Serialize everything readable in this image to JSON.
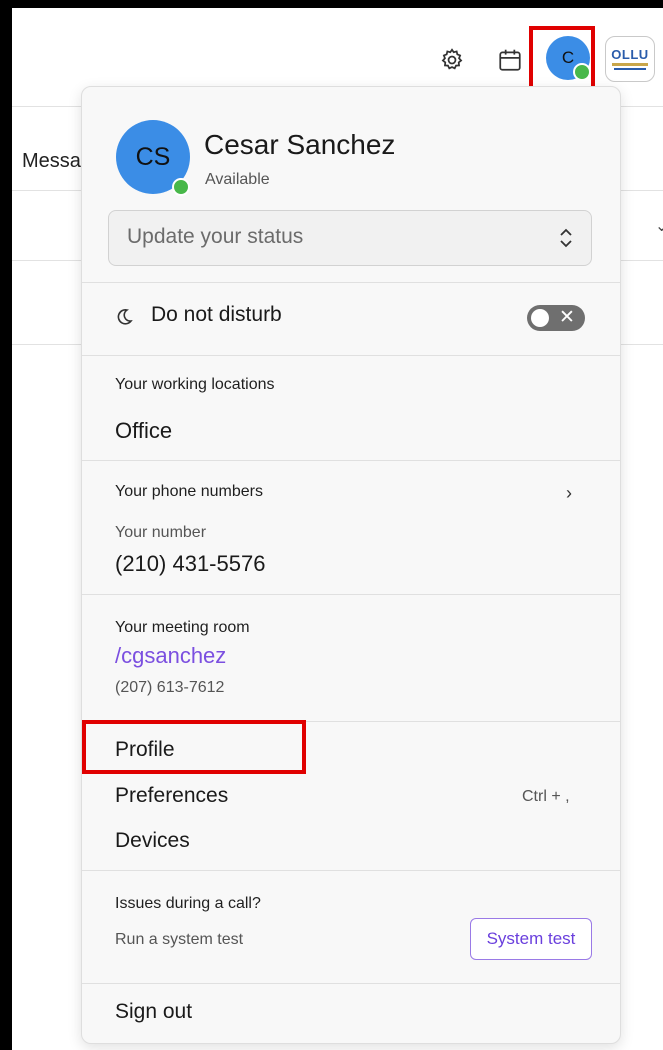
{
  "background": {
    "list_header_label": "Messa",
    "row_chevron": "⌄"
  },
  "header": {
    "icons": [
      "gear-icon",
      "calendar-icon"
    ],
    "avatar_initial": "C",
    "org_logo_text": "OLLU"
  },
  "profile_menu": {
    "user": {
      "initials": "CS",
      "name": "Cesar Sanchez",
      "presence": "Available",
      "status_placeholder": "Update your status"
    },
    "do_not_disturb": {
      "label": "Do not disturb",
      "enabled": false
    },
    "working_locations": {
      "title": "Your working locations",
      "value": "Office"
    },
    "phone_numbers": {
      "title": "Your phone numbers",
      "number_label": "Your number",
      "number": "(210) 431-5576"
    },
    "meeting_room": {
      "title": "Your meeting room",
      "link": "/cgsanchez",
      "phone": "(207) 613-7612"
    },
    "items": [
      {
        "label": "Profile",
        "shortcut": ""
      },
      {
        "label": "Preferences",
        "shortcut": "Ctrl + ,"
      },
      {
        "label": "Devices",
        "shortcut": ""
      }
    ],
    "call_issues": {
      "title": "Issues during a call?",
      "subtitle": "Run a system test",
      "button": "System test"
    },
    "sign_out": "Sign out"
  },
  "colors": {
    "avatar": "#3b8de6",
    "presence_available": "#48b84a",
    "accent_purple": "#7b4fe0",
    "highlight_red": "#e00000"
  }
}
